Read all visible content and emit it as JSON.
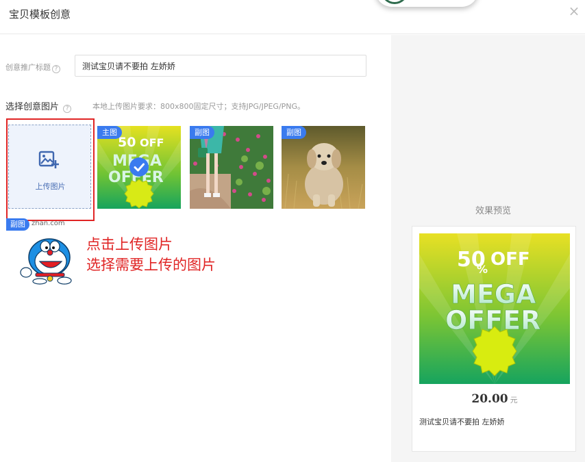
{
  "dialog": {
    "title": "宝贝模板创意",
    "close_glyph": "×"
  },
  "form": {
    "title_label": "创意推广标题",
    "title_value": "测试宝贝请不要拍 左娇娇",
    "help_glyph": "?",
    "image_label": "选择创意图片",
    "image_hint": "本地上传图片要求：800x800固定尺寸；支持JPG/JPEG/PNG。"
  },
  "upload": {
    "label": "上传图片",
    "icon": "image-add-icon"
  },
  "thumbnails": [
    {
      "tag": "主图",
      "selected": true,
      "image": "mega-offer-banner"
    },
    {
      "tag": "副图",
      "selected": false,
      "image": "woman-in-flower-field"
    },
    {
      "tag": "副图",
      "selected": false,
      "image": "puppy-in-grass"
    }
  ],
  "extra_item": {
    "tag": "副图",
    "watermark": "zhan.com",
    "image": "doraemon-sticker"
  },
  "annotation": {
    "line1": "点击上传图片",
    "line2": "选择需要上传的图片"
  },
  "promo": {
    "discount": "50",
    "percent": "%",
    "off": "OFF",
    "mega": "MEGA",
    "offer": "OFFER"
  },
  "preview": {
    "label": "效果预览",
    "price": "20.00",
    "unit": "元",
    "title": "测试宝贝请不要拍 左娇娇"
  },
  "colors": {
    "accent": "#3a7bef",
    "highlight": "#e02424",
    "upload_bg": "#eef3fc",
    "promo_yellow": "#e8e024",
    "promo_green": "#1aa35a"
  }
}
